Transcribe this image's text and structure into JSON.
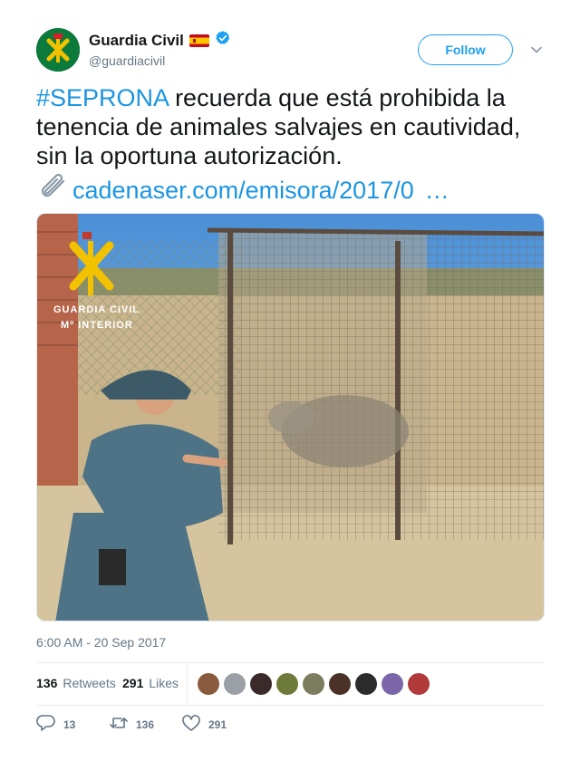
{
  "account": {
    "name": "Guardia Civil",
    "handle": "@guardiacivil",
    "follow_label": "Follow"
  },
  "tweet": {
    "hashtag": "#SEPRONA",
    "text": " recuerda que está prohibida la tenencia de animales salvajes en cautividad, sin la oportuna autorización.",
    "link_text": "cadenaser.com/emisora/2017/0",
    "link_ellipsis": "…"
  },
  "photo": {
    "watermark_line1": "GUARDIA CIVIL",
    "watermark_line2": "Mº INTERIOR"
  },
  "timestamp": "6:00 AM - 20 Sep 2017",
  "stats": {
    "retweets_count": "136",
    "retweets_label": "Retweets",
    "likes_count": "291",
    "likes_label": "Likes"
  },
  "actions": {
    "replies": "13",
    "retweets": "136",
    "likes": "291"
  },
  "colors": {
    "accent": "#1da1f2",
    "link": "#1b95e0",
    "muted": "#657786"
  },
  "icons": [
    "verified-badge-icon",
    "spain-flag-icon",
    "chevron-down-icon",
    "paperclip-icon",
    "reply-icon",
    "retweet-icon",
    "heart-icon"
  ]
}
